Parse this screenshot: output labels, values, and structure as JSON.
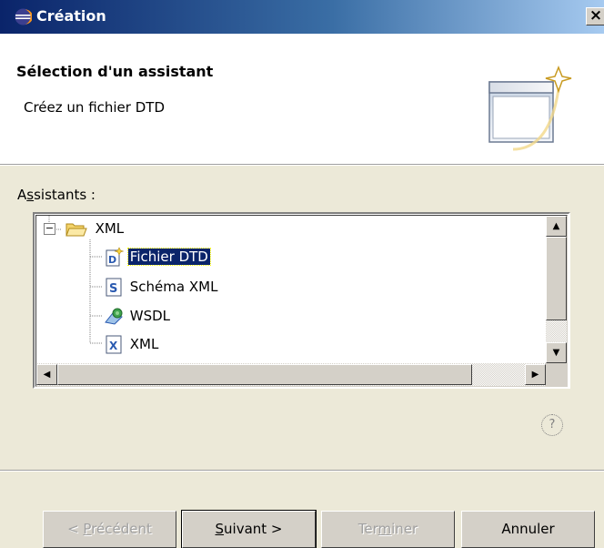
{
  "window": {
    "title": "Création",
    "close_label": "×"
  },
  "header": {
    "title": "Sélection d'un assistant",
    "description": "Créez un fichier DTD"
  },
  "wizards_label": {
    "prefix": "A",
    "mnemonic": "s",
    "suffix": "sistants :"
  },
  "tree": {
    "root": {
      "label": "XML",
      "expander": "−",
      "icon": "folder-open-icon"
    },
    "items": [
      {
        "label": "Fichier DTD",
        "icon": "dtd-file-icon",
        "selected": true
      },
      {
        "label": "Schéma XML",
        "icon": "schema-file-icon",
        "selected": false
      },
      {
        "label": "WSDL",
        "icon": "wsdl-icon",
        "selected": false
      },
      {
        "label": "XML",
        "icon": "xml-file-icon",
        "selected": false
      }
    ]
  },
  "help_label": "?",
  "buttons": {
    "back": {
      "prefix": "< ",
      "mnemonic": "P",
      "suffix": "récédent",
      "enabled": false
    },
    "next": {
      "prefix": "",
      "mnemonic": "S",
      "suffix": "uivant >",
      "enabled": true
    },
    "finish": {
      "prefix": "Ter",
      "mnemonic": "m",
      "suffix": "iner",
      "enabled": false
    },
    "cancel": {
      "label": "Annuler",
      "enabled": true
    }
  },
  "colors": {
    "selection": "#0a246a",
    "dialog_bg": "#ece9d8",
    "title_start": "#0a246a"
  }
}
